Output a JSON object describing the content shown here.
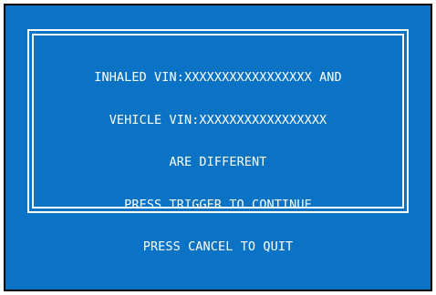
{
  "dialog": {
    "lines": [
      "INHALED VIN:XXXXXXXXXXXXXXXXX AND",
      "VEHICLE VIN:XXXXXXXXXXXXXXXXX",
      "ARE DIFFERENT",
      "PRESS TRIGGER TO CONTINUE",
      "PRESS CANCEL TO QUIT"
    ]
  },
  "colors": {
    "screen_background": "#0a73c6",
    "text": "#ffffff",
    "border": "#ffffff"
  }
}
